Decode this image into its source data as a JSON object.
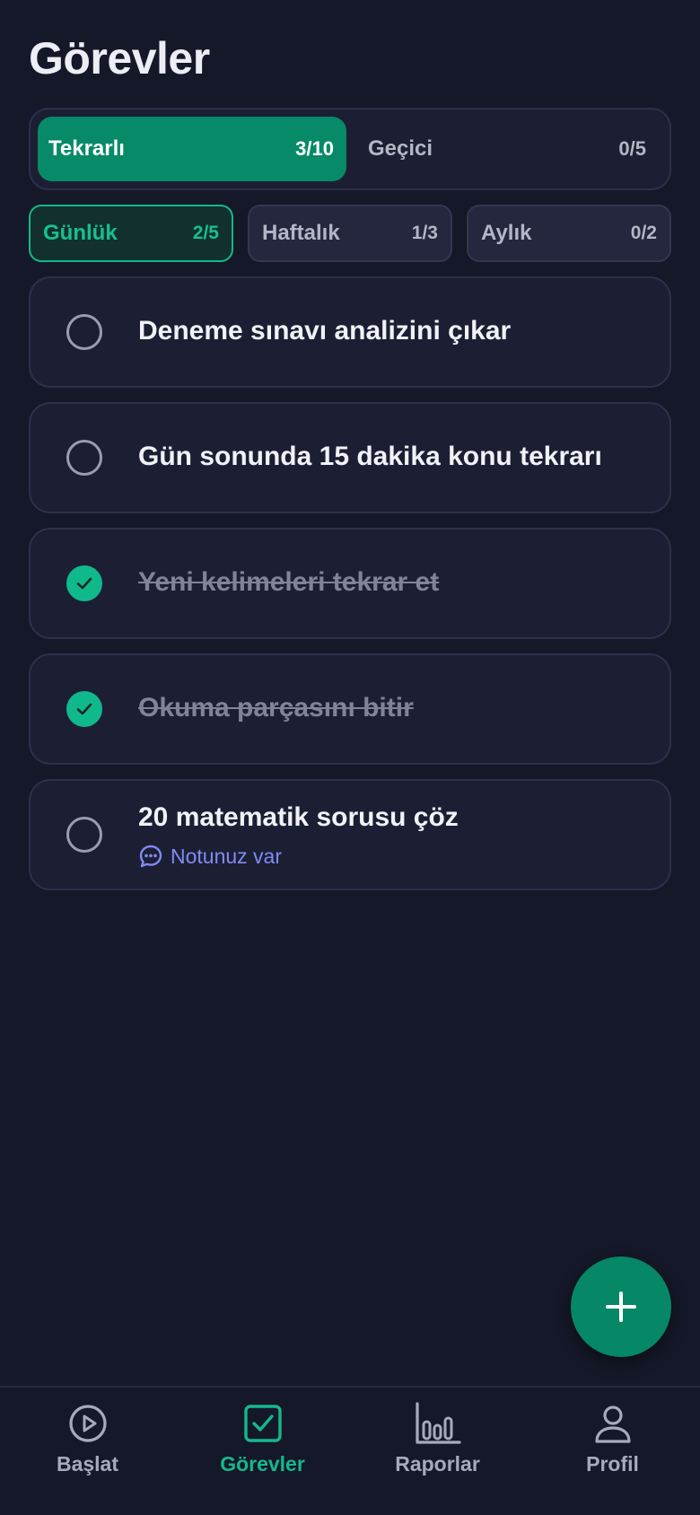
{
  "header": {
    "title": "Görevler"
  },
  "segment": {
    "left": {
      "label": "Tekrarlı",
      "count": "3/10"
    },
    "right": {
      "label": "Geçici",
      "count": "0/5"
    }
  },
  "periods": [
    {
      "label": "Günlük",
      "count": "2/5"
    },
    {
      "label": "Haftalık",
      "count": "1/3"
    },
    {
      "label": "Aylık",
      "count": "0/2"
    }
  ],
  "tasks": [
    {
      "label": "Deneme sınavı analizini çıkar",
      "done": false
    },
    {
      "label": "Gün sonunda 15 dakika konu tekrarı",
      "done": false
    },
    {
      "label": "Yeni kelimeleri tekrar et",
      "done": true
    },
    {
      "label": "Okuma parçasını bitir",
      "done": true
    },
    {
      "label": "20 matematik sorusu çöz",
      "done": false,
      "note": "Notunuz var"
    }
  ],
  "nav": {
    "items": [
      {
        "label": "Başlat",
        "icon": "play-circle-icon"
      },
      {
        "label": "Görevler",
        "icon": "checkbox-icon"
      },
      {
        "label": "Raporlar",
        "icon": "bar-chart-icon"
      },
      {
        "label": "Profil",
        "icon": "user-icon"
      }
    ],
    "active": "Görevler"
  },
  "colors": {
    "background": "#151828",
    "card": "#1C1F33",
    "accent": "#078A68",
    "accent_bright": "#10B98C",
    "note": "#7F8BF4"
  }
}
